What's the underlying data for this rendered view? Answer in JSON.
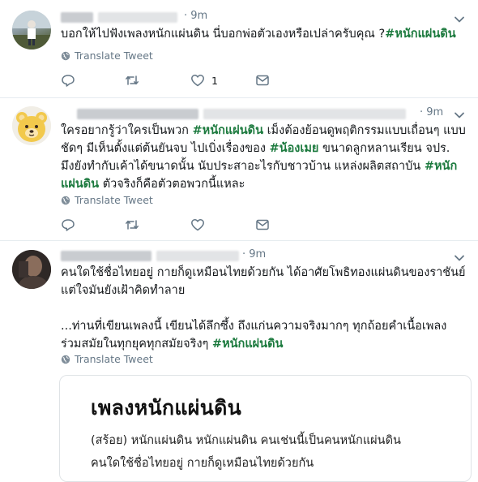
{
  "tweets": [
    {
      "time": "· 9m",
      "body": [
        {
          "t": "บอกให้ไปฟังเพลงหนักแผ่นดิน นี่บอกพ่อตัวเองหรือเปล่าครับคุณ ?"
        },
        {
          "t": "#หนักแผ่นดิน",
          "tag": true
        }
      ],
      "translate": "Translate Tweet",
      "like_count": "1"
    },
    {
      "time": "· 9m",
      "body": [
        {
          "t": "ใครอยากรู้ว่าใครเป็นพวก "
        },
        {
          "t": "#หนักแผ่นดิน",
          "tag": true
        },
        {
          "t": " เม็งต้องย้อนดูพฤติกรรมแบบเถื่อนๆ แบบชัดๆ มีเห็นตั้งแต่ต้นยันจบ  ไปเบิ่งเรื่องของ "
        },
        {
          "t": "#น้องเมย",
          "tag": true
        },
        {
          "t": " ขนาดลูกหลานเรียน จปร. มึงยังทำกับเค้าได้ขนาดนั้น นับประสาอะไรกับชาวบ้าน แหล่งผลิตสถาบัน "
        },
        {
          "t": "#หนักแผ่นดิน",
          "tag": true
        },
        {
          "t": " ตัวจริงก็คือตัวตอพวกนี้แหละ"
        }
      ],
      "translate": "Translate Tweet"
    },
    {
      "time": "· 9m",
      "body": [
        {
          "t": "คนใดใช้ชื่อไทยอยู่ กายก็ดูเหมือนไทยด้วยกัน ได้อาศัยโพธิทองแผ่นดินของราชันย์ แต่ใจมันยังเฝ้าคิดทำลาย"
        },
        {
          "t": "\n\n"
        },
        {
          "t": "...ท่านที่เขียนเพลงนี้ เขียนได้ลึกซึ้ง ถึงแก่นความจริงมากๆ ทุกถ้อยคำเนื้อเพลง ร่วมสมัยในทุกยุคทุกสมัยจริงๆ "
        },
        {
          "t": "#หนักแผ่นดิน",
          "tag": true
        }
      ],
      "translate": "Translate Tweet",
      "card": {
        "title": "เพลงหนักแผ่นดิน",
        "line1": "(สร้อย) หนักแผ่นดิน หนักแผ่นดิน คนเช่นนี้เป็นคนหนักแผ่นดิน",
        "line2": "คนใดใช้ชื่อไทยอยู่ กายก็ดูเหมือนไทยด้วยกัน"
      }
    }
  ],
  "colors": {
    "hashtag": "#1c7a3e",
    "muted": "#657786",
    "border": "#e6ecf0"
  },
  "icons": {
    "reply": "reply-icon",
    "retweet": "retweet-icon",
    "like": "heart-icon",
    "dm": "envelope-icon",
    "translate": "globe-icon",
    "menu": "chevron-down-icon"
  }
}
